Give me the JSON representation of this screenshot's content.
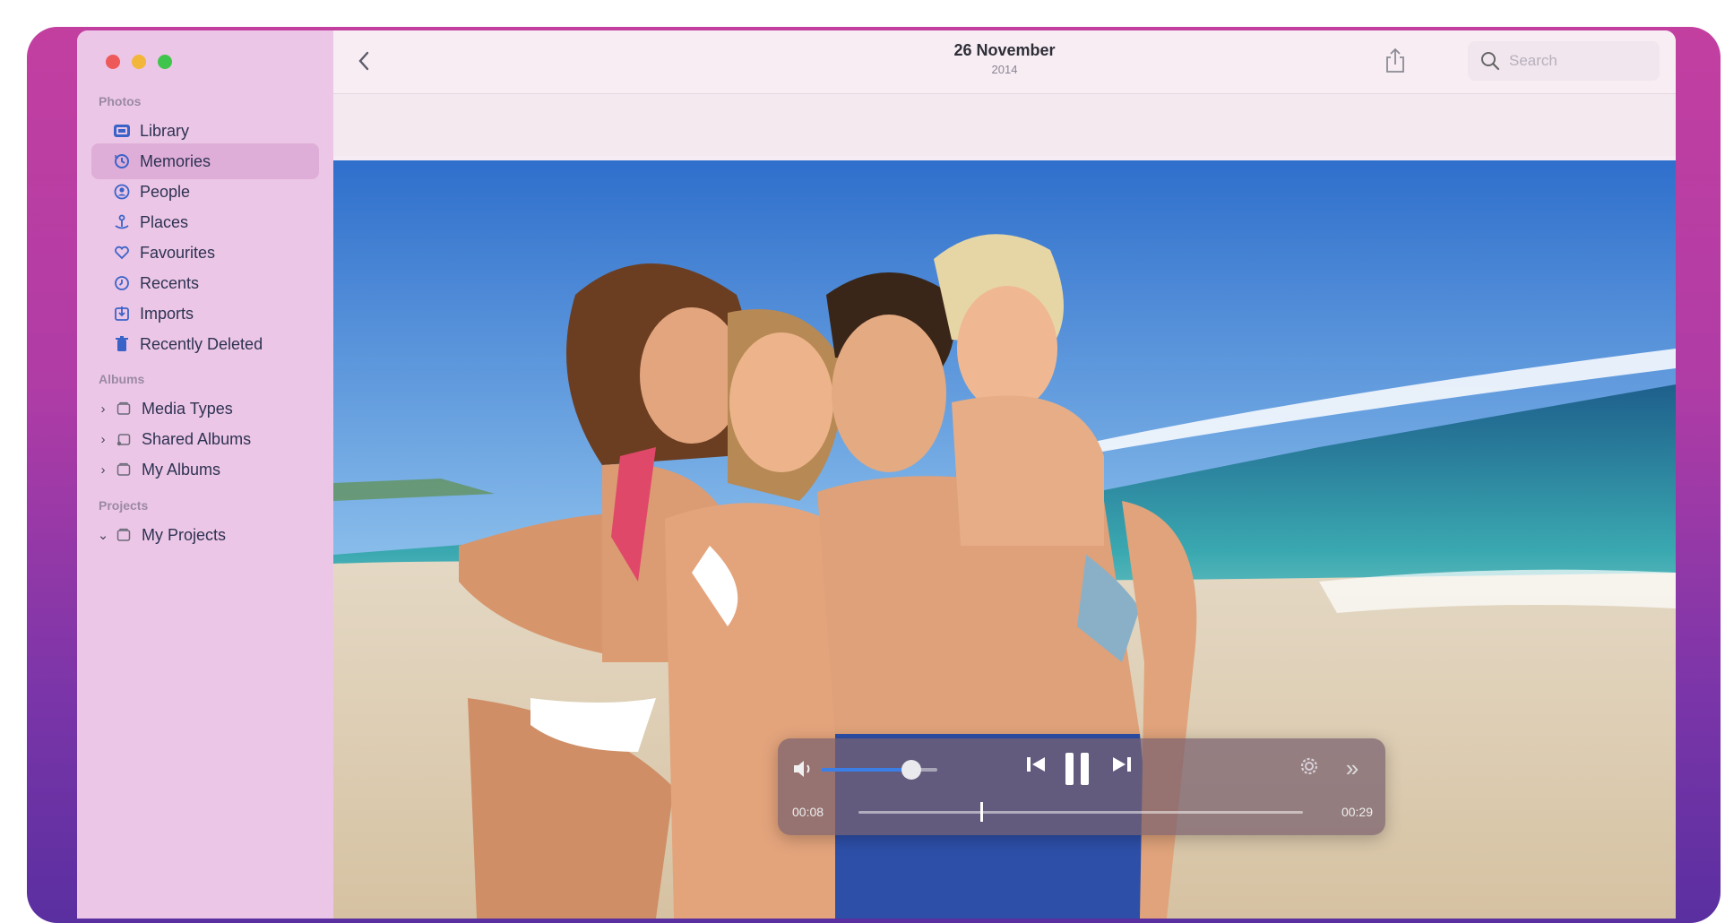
{
  "window": {
    "traffic_lights": [
      "close",
      "minimize",
      "zoom"
    ]
  },
  "sidebar": {
    "sections": {
      "photos": "Photos",
      "albums": "Albums",
      "projects": "Projects"
    },
    "items": [
      {
        "label": "Library",
        "icon": "library-icon"
      },
      {
        "label": "Memories",
        "icon": "memories-icon",
        "selected": true
      },
      {
        "label": "People",
        "icon": "people-icon"
      },
      {
        "label": "Places",
        "icon": "places-icon"
      },
      {
        "label": "Favourites",
        "icon": "heart-icon"
      },
      {
        "label": "Recents",
        "icon": "clock-icon"
      },
      {
        "label": "Imports",
        "icon": "import-icon"
      },
      {
        "label": "Recently Deleted",
        "icon": "trash-icon"
      }
    ],
    "albums": [
      {
        "label": "Media Types",
        "expanded": false
      },
      {
        "label": "Shared Albums",
        "expanded": false
      },
      {
        "label": "My Albums",
        "expanded": false
      }
    ],
    "projects": [
      {
        "label": "My Projects",
        "expanded": true
      }
    ]
  },
  "toolbar": {
    "title": "26 November",
    "subtitle": "2014",
    "search_placeholder": "Search"
  },
  "player": {
    "elapsed": "00:08",
    "total": "00:29",
    "progress": 0.276,
    "volume": 0.78,
    "state": "playing"
  },
  "colors": {
    "accent": "#3b7fe6",
    "sidebar_bg": "#ecc6e6",
    "wallpaper": "#b03ca6"
  }
}
